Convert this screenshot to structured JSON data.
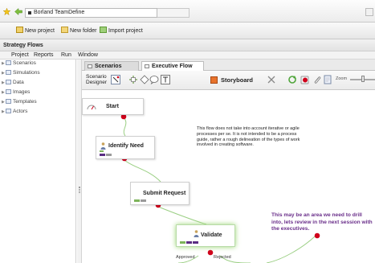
{
  "topbar": {
    "app_tab_label": "Borland TeamDefine"
  },
  "toolbar": {
    "new_project": "New project",
    "new_folder": "New folder",
    "import_project": "Import project"
  },
  "panel": {
    "title": "Strategy Flows",
    "menu": [
      "Project",
      "Reports",
      "Run",
      "Window"
    ]
  },
  "tree": {
    "items": [
      "Scenarios",
      "Simulations",
      "Data",
      "Images",
      "Templates",
      "Actors"
    ]
  },
  "editor": {
    "tabs": [
      "Scenarios",
      "Executive Flow"
    ],
    "designer_label": "Scenario Designer",
    "storyboard_label": "Storyboard",
    "zoom_label": "Zoom"
  },
  "flow": {
    "nodes": [
      "Start",
      "Identify Need",
      "Submit Request",
      "Validate"
    ],
    "edge_labels": [
      "Approved",
      "Rejected"
    ],
    "note_text": "This flow does not take into account iterative or agile processes per se. It is not intended to be a process guide, rather a rough delineation of the types of work involved in creating software.",
    "callout_text": "This may be an area we need to drill into, lets review in the next session with the executives."
  },
  "colors": {
    "callout_text": "#6a2f8a",
    "connector_dot": "#d0021b",
    "connector_line": "#9bcf84",
    "highlight_glow": "#98d56f",
    "swatch_green": "#7db35a",
    "swatch_purple": "#5a2d82",
    "swatch_gray": "#9a9a9a"
  }
}
